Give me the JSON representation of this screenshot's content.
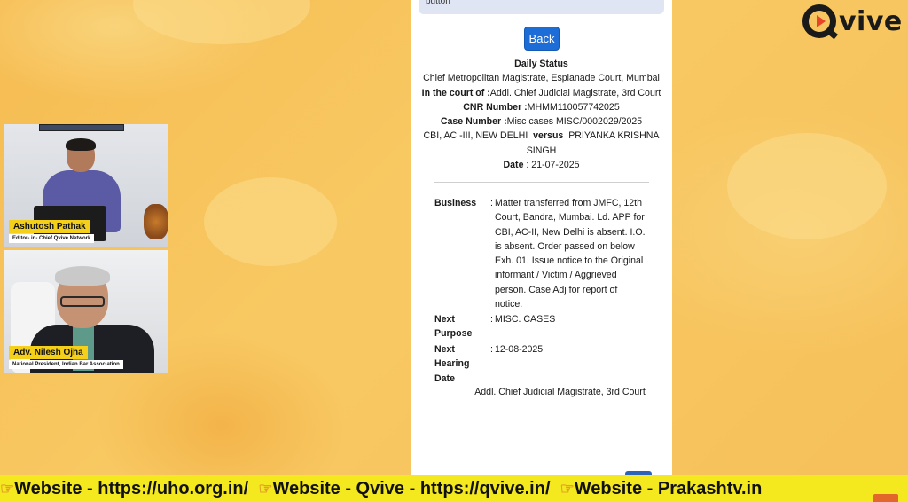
{
  "logo": {
    "text": "vive"
  },
  "videos": [
    {
      "name": "Ashutosh Pathak",
      "title": "Editor- in- Chief Qvive Network"
    },
    {
      "name": "Adv. Nilesh Ojha",
      "title": "National President, Indian Bar Association"
    }
  ],
  "page": {
    "top_note": "button",
    "back_label": "Back",
    "heading": "Daily Status",
    "court_line": "Chief Metropolitan Magistrate, Esplanade Court, Mumbai",
    "in_court_label": "In the court of :",
    "in_court_value": "Addl. Chief Judicial Magistrate, 3rd Court",
    "cnr_label": "CNR Number :",
    "cnr_value": "MHMM110057742025",
    "case_label": "Case Number :",
    "case_value": "Misc cases MISC/0002029/2025",
    "party_left": "CBI, AC -III, NEW DELHI",
    "versus": "versus",
    "party_right_1": "PRIYANKA KRISHNA",
    "party_right_2": "SINGH",
    "date_label": "Date",
    "date_value": ": 21-07-2025",
    "business_label": "Business",
    "business_lines": [
      "Matter transferred from JMFC, 12th",
      "Court, Bandra, Mumbai. Ld. APP for",
      "CBI, AC-II, New Delhi is absent. I.O.",
      "is absent. Order passed on below",
      "Exh. 01. Issue notice to the Original",
      "informant / Victim / Aggrieved",
      "person. Case Adj for report of",
      "notice."
    ],
    "next_purpose_label_1": "Next",
    "next_purpose_label_2": "Purpose",
    "next_purpose_value": "MISC. CASES",
    "next_hearing_label_1": "Next",
    "next_hearing_label_2": "Hearing",
    "next_hearing_label_3": "Date",
    "next_hearing_value": "12-08-2025",
    "signature": "Addl. Chief Judicial Magistrate, 3rd Court",
    "colon": ":"
  },
  "ticker": {
    "items": [
      "Website - https://uho.org.in/",
      "Website - Qvive - https://qvive.in/",
      "Website - Prakashtv.in"
    ],
    "icon": "pointing-hand-icon"
  },
  "colors": {
    "background": "#f7c25a",
    "ticker": "#f4e81f",
    "back_button": "#1c6dd8",
    "name_tag": "#f4d01b"
  }
}
